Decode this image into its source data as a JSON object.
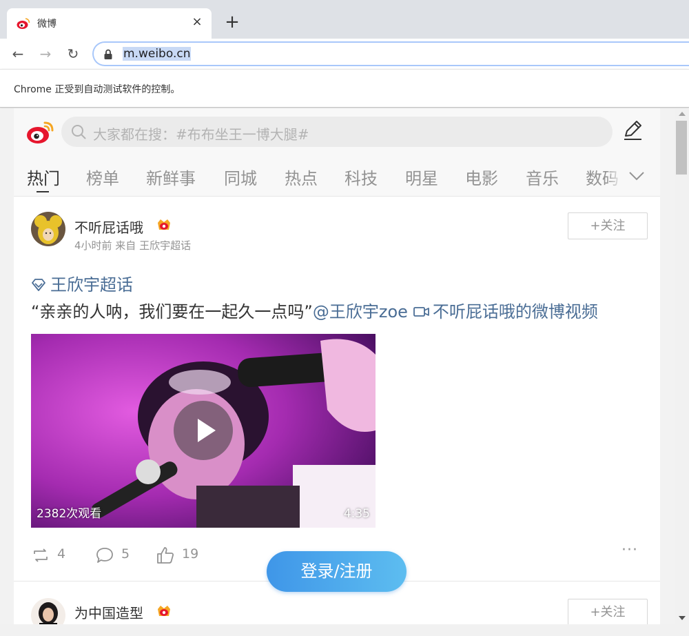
{
  "browser": {
    "tab_title": "微博",
    "tab_close": "×",
    "new_tab": "+",
    "back_icon": "←",
    "forward_icon": "→",
    "reload_icon": "↻",
    "url": "m.weibo.cn",
    "infobar_text": "Chrome 正受到自动测试软件的控制。"
  },
  "header": {
    "search_placeholder": "大家都在搜：#布布坐王一博大腿#"
  },
  "tabs": [
    {
      "label": "热门",
      "active": true
    },
    {
      "label": "榜单",
      "active": false
    },
    {
      "label": "新鲜事",
      "active": false
    },
    {
      "label": "同城",
      "active": false
    },
    {
      "label": "热点",
      "active": false
    },
    {
      "label": "科技",
      "active": false
    },
    {
      "label": "明星",
      "active": false
    },
    {
      "label": "电影",
      "active": false
    },
    {
      "label": "音乐",
      "active": false
    },
    {
      "label": "数码",
      "active": false
    }
  ],
  "posts": [
    {
      "user_name": "不听屁话哦",
      "meta": "4小时前 来自 王欣宇超话",
      "follow_label": "+关注",
      "topic": "王欣宇超话",
      "text_quote": "“亲亲的人呐，我们要在一起久一点吗”",
      "mention": "@王欣宇zoe",
      "video_link": "不听屁话哦的微博视频",
      "video_views": "2382次观看",
      "video_duration": "4:35",
      "reposts": "4",
      "comments": "5",
      "likes": "19",
      "more": "···"
    },
    {
      "user_name": "为中国造型",
      "follow_label": "+关注"
    }
  ],
  "login_button": "登录/注册",
  "colors": {
    "link": "#4a6d95",
    "muted": "#939393",
    "login_gradient_start": "#3f96e8",
    "login_gradient_end": "#5dbdf0",
    "weibo_red": "#e6162d"
  }
}
